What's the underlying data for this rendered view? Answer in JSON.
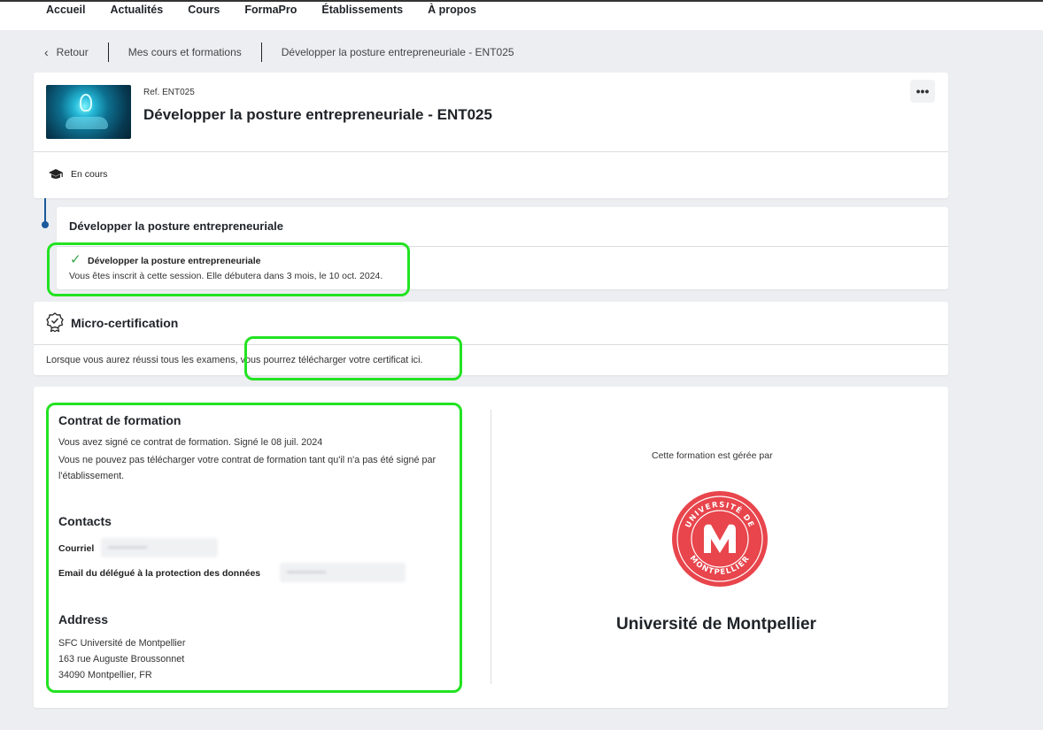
{
  "nav": {
    "items": [
      "Accueil",
      "Actualités",
      "Cours",
      "FormaPro",
      "Établissements",
      "À propos"
    ]
  },
  "breadcrumb": {
    "back": "Retour",
    "parent": "Mes cours et formations",
    "current": "Développer la posture entrepreneuriale - ENT025"
  },
  "course": {
    "ref": "Ref. ENT025",
    "title": "Développer la posture entrepreneuriale - ENT025",
    "status": "En cours"
  },
  "module": {
    "title": "Développer la posture entrepreneuriale",
    "session_name": "Développer la posture entrepreneuriale",
    "session_info": "Vous êtes inscrit à cette session. Elle débutera dans 3 mois, le 10 oct. 2024."
  },
  "micro": {
    "title": "Micro-certification",
    "text": "Lorsque vous aurez réussi tous les examens, vous pourrez télécharger votre certificat ici."
  },
  "contract": {
    "title": "Contrat de formation",
    "line1": "Vous avez signé ce contrat de formation. Signé le 08 juil. 2024",
    "line2": "Vous ne pouvez pas télécharger votre contrat de formation tant qu'il n'a pas été signé par l'établissement."
  },
  "contacts": {
    "title": "Contacts",
    "email_label": "Courriel",
    "dpo_label": "Email du délégué à la protection des données"
  },
  "address": {
    "title": "Address",
    "line1": "SFC Université de Montpellier",
    "line2": "163 rue Auguste Broussonnet",
    "line3": "34090 Montpellier, FR"
  },
  "manager": {
    "intro": "Cette formation est gérée par",
    "name": "Université de Montpellier",
    "logo_ring_top": "UNIVERSITÉ DE",
    "logo_ring_bottom": "MONTPELLIER"
  },
  "colors": {
    "highlight": "#22e322",
    "timeline": "#1b5a9c",
    "logo_red": "#e8454c",
    "check": "#3aa347"
  },
  "icons": {
    "more": "more-dots-icon",
    "status": "graduation-cap-icon",
    "micro": "award-badge-icon",
    "check": "check-icon",
    "back": "chevron-left-icon"
  }
}
